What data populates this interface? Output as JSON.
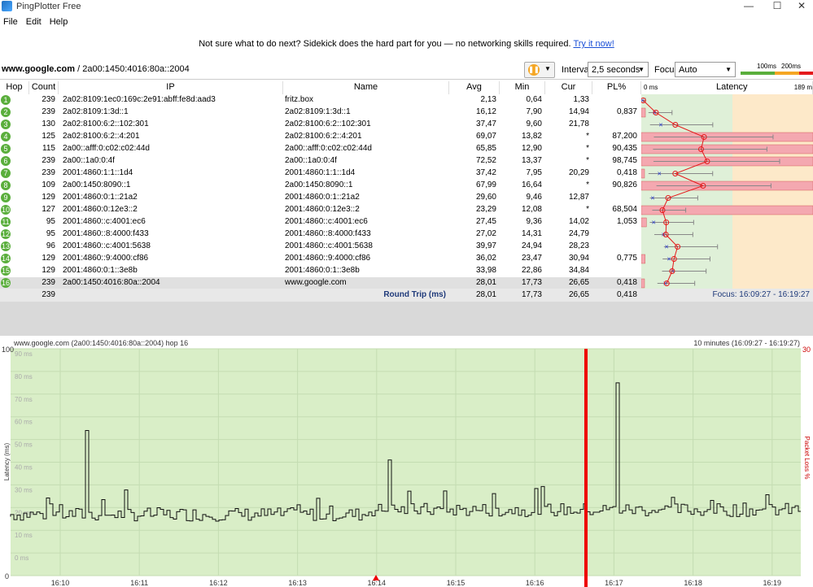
{
  "app": {
    "title": "PingPlotter Free"
  },
  "menu": [
    "File",
    "Edit",
    "Help"
  ],
  "banner": {
    "text": "Not sure what to do next? Sidekick does the hard part for you — no networking skills required.",
    "link": "Try it now!"
  },
  "toolbar": {
    "target_host": "www.google.com",
    "target_rest": " / 2a00:1450:4016:80a::2004",
    "interval_label": "Interval",
    "interval_value": "2,5 seconds",
    "focus_label": "Focus",
    "focus_value": "Auto",
    "legend_100": "100ms",
    "legend_200": "200ms"
  },
  "columns": {
    "hop": "Hop",
    "count": "Count",
    "ip": "IP",
    "name": "Name",
    "avg": "Avg",
    "min": "Min",
    "cur": "Cur",
    "pl": "PL%",
    "latency_min": "0 ms",
    "latency": "Latency",
    "latency_max": "189 m"
  },
  "hops": [
    {
      "hop": "1",
      "count": "239",
      "ip": "2a02:8109:1ec0:169c:2e91:abff:fe8d:aad3",
      "name": "fritz.box",
      "avg": "2,13",
      "min": "0,64",
      "cur": "1,33",
      "pl": ""
    },
    {
      "hop": "2",
      "count": "239",
      "ip": "2a02:8109:1:3d::1",
      "name": "2a02:8109:1:3d::1",
      "avg": "16,12",
      "min": "7,90",
      "cur": "14,94",
      "pl": "0,837"
    },
    {
      "hop": "3",
      "count": "130",
      "ip": "2a02:8100:6:2::102:301",
      "name": "2a02:8100:6:2::102:301",
      "avg": "37,47",
      "min": "9,60",
      "cur": "21,78",
      "pl": ""
    },
    {
      "hop": "4",
      "count": "125",
      "ip": "2a02:8100:6:2::4:201",
      "name": "2a02:8100:6:2::4:201",
      "avg": "69,07",
      "min": "13,82",
      "cur": "*",
      "pl": "87,200"
    },
    {
      "hop": "5",
      "count": "115",
      "ip": "2a00::afff:0:c02:c02:44d",
      "name": "2a00::afff:0:c02:c02:44d",
      "avg": "65,85",
      "min": "12,90",
      "cur": "*",
      "pl": "90,435"
    },
    {
      "hop": "6",
      "count": "239",
      "ip": "2a00::1a0:0:4f",
      "name": "2a00::1a0:0:4f",
      "avg": "72,52",
      "min": "13,37",
      "cur": "*",
      "pl": "98,745"
    },
    {
      "hop": "7",
      "count": "239",
      "ip": "2001:4860:1:1::1d4",
      "name": "2001:4860:1:1::1d4",
      "avg": "37,42",
      "min": "7,95",
      "cur": "20,29",
      "pl": "0,418"
    },
    {
      "hop": "8",
      "count": "109",
      "ip": "2a00:1450:8090::1",
      "name": "2a00:1450:8090::1",
      "avg": "67,99",
      "min": "16,64",
      "cur": "*",
      "pl": "90,826"
    },
    {
      "hop": "9",
      "count": "129",
      "ip": "2001:4860:0:1::21a2",
      "name": "2001:4860:0:1::21a2",
      "avg": "29,60",
      "min": "9,46",
      "cur": "12,87",
      "pl": ""
    },
    {
      "hop": "10",
      "count": "127",
      "ip": "2001:4860:0:12e3::2",
      "name": "2001:4860:0:12e3::2",
      "avg": "23,29",
      "min": "12,08",
      "cur": "*",
      "pl": "68,504"
    },
    {
      "hop": "11",
      "count": "95",
      "ip": "2001:4860::c:4001:ec6",
      "name": "2001:4860::c:4001:ec6",
      "avg": "27,45",
      "min": "9,36",
      "cur": "14,02",
      "pl": "1,053"
    },
    {
      "hop": "12",
      "count": "95",
      "ip": "2001:4860::8:4000:f433",
      "name": "2001:4860::8:4000:f433",
      "avg": "27,02",
      "min": "14,31",
      "cur": "24,79",
      "pl": ""
    },
    {
      "hop": "13",
      "count": "96",
      "ip": "2001:4860::c:4001:5638",
      "name": "2001:4860::c:4001:5638",
      "avg": "39,97",
      "min": "24,94",
      "cur": "28,23",
      "pl": ""
    },
    {
      "hop": "14",
      "count": "129",
      "ip": "2001:4860::9:4000:cf86",
      "name": "2001:4860::9:4000:cf86",
      "avg": "36,02",
      "min": "23,47",
      "cur": "30,94",
      "pl": "0,775"
    },
    {
      "hop": "15",
      "count": "129",
      "ip": "2001:4860:0:1::3e8b",
      "name": "2001:4860:0:1::3e8b",
      "avg": "33,98",
      "min": "22,86",
      "cur": "34,84",
      "pl": ""
    },
    {
      "hop": "16",
      "count": "239",
      "ip": "2a00:1450:4016:80a::2004",
      "name": "www.google.com",
      "avg": "28,01",
      "min": "17,73",
      "cur": "26,65",
      "pl": "0,418"
    }
  ],
  "summary": {
    "count": "239",
    "label": "Round Trip (ms)",
    "avg": "28,01",
    "min": "17,73",
    "cur": "26,65",
    "pl": "0,418",
    "focus": "Focus: 16:09:27 - 16:19:27"
  },
  "timeline": {
    "title": "www.google.com (2a00:1450:4016:80a::2004) hop 16",
    "range": "10 minutes (16:09:27 - 16:19:27)",
    "y_max": "100",
    "y_min": "0",
    "pl_max": "30",
    "y_ticks": [
      "90 ms",
      "80 ms",
      "70 ms",
      "60 ms",
      "50 ms",
      "40 ms",
      "30 ms",
      "20 ms",
      "10 ms",
      "0 ms"
    ],
    "ylabel": "Latency (ms)",
    "ylabel_right": "Packet Loss %",
    "x_ticks": [
      "16:10",
      "16:11",
      "16:12",
      "16:13",
      "16:14",
      "16:15",
      "16:16",
      "16:17",
      "16:18",
      "16:19"
    ]
  },
  "chart_data": {
    "type": "line",
    "title": "www.google.com (2a00:1450:4016:80a::2004) hop 16",
    "xlabel": "",
    "ylabel": "Latency (ms)",
    "ylim": [
      0,
      100
    ],
    "x_ticks": [
      "16:10",
      "16:11",
      "16:12",
      "16:13",
      "16:14",
      "16:15",
      "16:16",
      "16:17",
      "16:18",
      "16:19"
    ],
    "spikes": [
      {
        "time": "16:10",
        "ms": 64
      },
      {
        "time": "16:14",
        "ms": 51
      },
      {
        "time": "16:17",
        "ms": 68
      },
      {
        "time": "16:17",
        "ms": 85
      }
    ],
    "baseline_ms": [
      24,
      32
    ],
    "packet_loss_marker_time": "16:16:40",
    "grid": true
  },
  "colors": {
    "green": "#5aae3c",
    "loss": "#f4a8b0",
    "good_bg": "#dff0d8",
    "warn_bg": "#fde9c9",
    "accent": "#e41a1c"
  }
}
